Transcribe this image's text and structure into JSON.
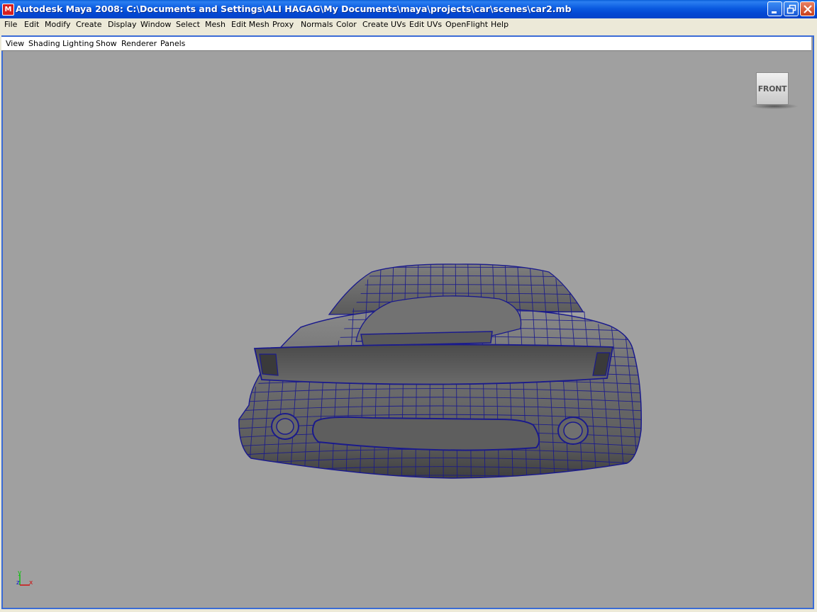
{
  "window": {
    "title": "Autodesk Maya 2008: C:\\Documents and Settings\\ALI HAGAG\\My Documents\\maya\\projects\\car\\scenes\\car2.mb",
    "app_icon": "maya-icon",
    "controls": [
      "minimize-icon",
      "restore-icon",
      "close-icon"
    ]
  },
  "menubar": {
    "items": [
      "File",
      "Edit",
      "Modify",
      "Create",
      "Display",
      "Window",
      "Select",
      "Mesh",
      "Edit Mesh",
      "Proxy",
      "Normals",
      "Color",
      "Create UVs",
      "Edit UVs",
      "OpenFlight",
      "Help"
    ]
  },
  "panel": {
    "menu": [
      "View",
      "Shading",
      "Lighting",
      "Show",
      "Renderer",
      "Panels"
    ]
  },
  "viewport": {
    "viewcube_label": "FRONT",
    "axis": {
      "y": "y",
      "z": "z",
      "x": "x"
    },
    "model": "car front wireframe-on-shaded mesh",
    "colors": {
      "background": "#a0a0a0",
      "wireframe": "#1a1a8c",
      "surface": "#6e6e6e",
      "x_axis": "#d01010",
      "y_axis": "#10c010",
      "z_axis": "#1020d0"
    }
  }
}
